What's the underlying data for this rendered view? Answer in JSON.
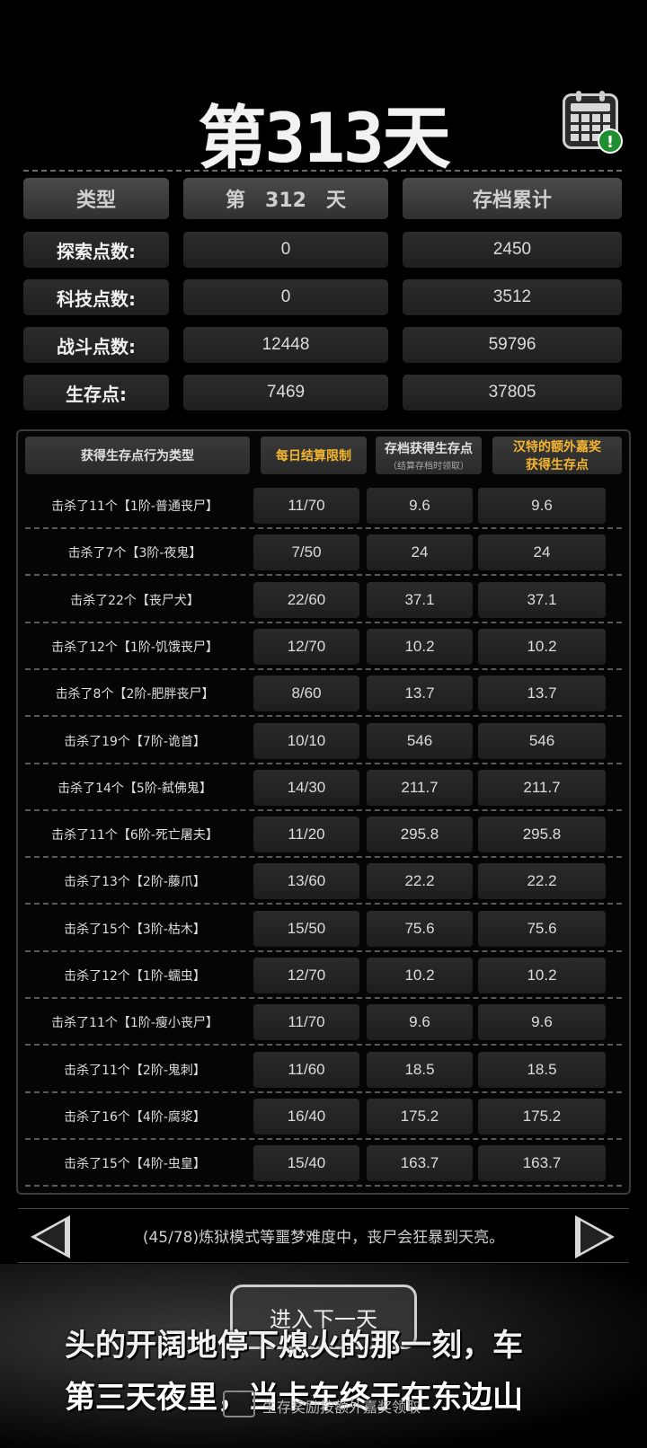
{
  "title": "第313天",
  "calendar_badge": "!",
  "summary": {
    "headers": {
      "type": "类型",
      "day": "第　312　天",
      "archive": "存档累计"
    },
    "rows": [
      {
        "label": "探索点数:",
        "day": "0",
        "archive": "2450"
      },
      {
        "label": "科技点数:",
        "day": "0",
        "archive": "3512"
      },
      {
        "label": "战斗点数:",
        "day": "12448",
        "archive": "59796"
      },
      {
        "label": "生存点:",
        "day": "7469",
        "archive": "37805"
      }
    ]
  },
  "table": {
    "headers": {
      "action": "获得生存点行为类型",
      "limit": "每日结算限制",
      "archive": "存档获得生存点",
      "archive_sub": "（结算存档时领取）",
      "bonus_line1": "汉特的额外嘉奖",
      "bonus_line2": "获得生存点"
    },
    "rows": [
      {
        "action": "击杀了11个【1阶-普通丧尸】",
        "limit": "11/70",
        "archive": "9.6",
        "bonus": "9.6"
      },
      {
        "action": "击杀了7个【3阶-夜鬼】",
        "limit": "7/50",
        "archive": "24",
        "bonus": "24"
      },
      {
        "action": "击杀了22个【丧尸犬】",
        "limit": "22/60",
        "archive": "37.1",
        "bonus": "37.1"
      },
      {
        "action": "击杀了12个【1阶-饥饿丧尸】",
        "limit": "12/70",
        "archive": "10.2",
        "bonus": "10.2"
      },
      {
        "action": "击杀了8个【2阶-肥胖丧尸】",
        "limit": "8/60",
        "archive": "13.7",
        "bonus": "13.7"
      },
      {
        "action": "击杀了19个【7阶-诡首】",
        "limit": "10/10",
        "archive": "546",
        "bonus": "546"
      },
      {
        "action": "击杀了14个【5阶-弑佛鬼】",
        "limit": "14/30",
        "archive": "211.7",
        "bonus": "211.7"
      },
      {
        "action": "击杀了11个【6阶-死亡屠夫】",
        "limit": "11/20",
        "archive": "295.8",
        "bonus": "295.8"
      },
      {
        "action": "击杀了13个【2阶-藤爪】",
        "limit": "13/60",
        "archive": "22.2",
        "bonus": "22.2"
      },
      {
        "action": "击杀了15个【3阶-枯木】",
        "limit": "15/50",
        "archive": "75.6",
        "bonus": "75.6"
      },
      {
        "action": "击杀了12个【1阶-蠕虫】",
        "limit": "12/70",
        "archive": "10.2",
        "bonus": "10.2"
      },
      {
        "action": "击杀了11个【1阶-瘦小丧尸】",
        "limit": "11/70",
        "archive": "9.6",
        "bonus": "9.6"
      },
      {
        "action": "击杀了11个【2阶-鬼刺】",
        "limit": "11/60",
        "archive": "18.5",
        "bonus": "18.5"
      },
      {
        "action": "击杀了16个【4阶-腐浆】",
        "limit": "16/40",
        "archive": "175.2",
        "bonus": "175.2"
      },
      {
        "action": "击杀了15个【4阶-虫皇】",
        "limit": "15/40",
        "archive": "163.7",
        "bonus": "163.7"
      }
    ]
  },
  "tip": "(45/78)炼狱模式等噩梦难度中，丧尸会狂暴到天亮。",
  "next_button": "进入下一天",
  "story": {
    "line1": "头的开阔地停下熄火的那一刻，车",
    "line2": "第三天夜里，当卡车终于在东边山"
  },
  "skip_label": "生存奖励按额外嘉奖领取"
}
